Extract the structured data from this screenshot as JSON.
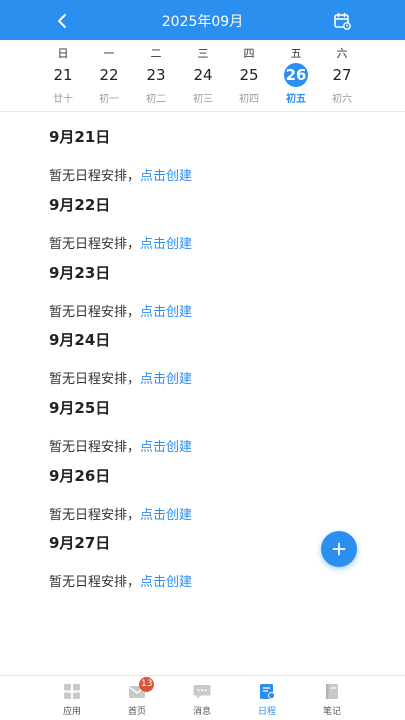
{
  "header": {
    "title": "2025年09月",
    "back_icon": "chevron-left-icon",
    "calendar_icon": "calendar-icon",
    "color": "#2b8ff0"
  },
  "week": [
    {
      "dow": "日",
      "day": "21",
      "lunar": "廿十",
      "selected": false
    },
    {
      "dow": "一",
      "day": "22",
      "lunar": "初一",
      "selected": false
    },
    {
      "dow": "二",
      "day": "23",
      "lunar": "初二",
      "selected": false
    },
    {
      "dow": "三",
      "day": "24",
      "lunar": "初三",
      "selected": false
    },
    {
      "dow": "四",
      "day": "25",
      "lunar": "初四",
      "selected": false
    },
    {
      "dow": "五",
      "day": "26",
      "lunar": "初五",
      "selected": true
    },
    {
      "dow": "六",
      "day": "27",
      "lunar": "初六",
      "selected": false
    }
  ],
  "schedule": [
    {
      "date": "9月21日",
      "empty_text": "暂无日程安排，",
      "create_label": "点击创建"
    },
    {
      "date": "9月22日",
      "empty_text": "暂无日程安排，",
      "create_label": "点击创建"
    },
    {
      "date": "9月23日",
      "empty_text": "暂无日程安排，",
      "create_label": "点击创建"
    },
    {
      "date": "9月24日",
      "empty_text": "暂无日程安排，",
      "create_label": "点击创建"
    },
    {
      "date": "9月25日",
      "empty_text": "暂无日程安排，",
      "create_label": "点击创建"
    },
    {
      "date": "9月26日",
      "empty_text": "暂无日程安排，",
      "create_label": "点击创建"
    },
    {
      "date": "9月27日",
      "empty_text": "暂无日程安排，",
      "create_label": "点击创建"
    }
  ],
  "fab": {
    "icon": "plus-icon"
  },
  "tabbar": {
    "items": [
      {
        "label": "应用",
        "icon": "apps-icon",
        "active": false
      },
      {
        "label": "首页",
        "icon": "home-mail-icon",
        "active": false,
        "badge": "13"
      },
      {
        "label": "消息",
        "icon": "message-icon",
        "active": false
      },
      {
        "label": "日程",
        "icon": "schedule-icon",
        "active": true
      },
      {
        "label": "笔记",
        "icon": "notebook-icon",
        "active": false
      }
    ]
  }
}
